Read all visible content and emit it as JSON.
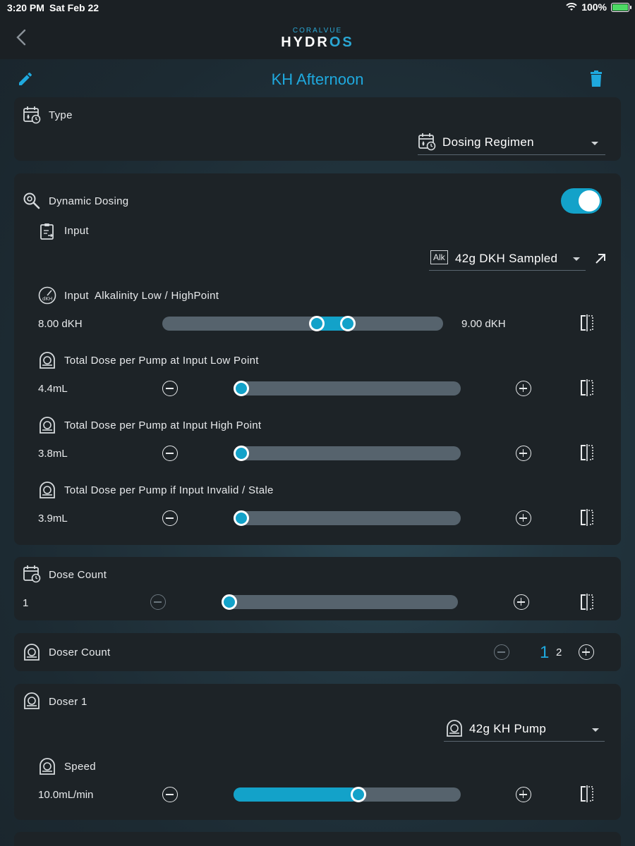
{
  "status": {
    "time": "3:20 PM",
    "date": "Sat Feb 22",
    "battery": "100%"
  },
  "nav": {
    "logo_sub": "CORALVUE",
    "logo_main_a": "HYDR",
    "logo_main_b": "OS"
  },
  "page": {
    "title": "KH Afternoon"
  },
  "type_card": {
    "label": "Type",
    "selected": "Dosing Regimen"
  },
  "dynamic": {
    "label": "Dynamic Dosing",
    "enabled": true,
    "input_label": "Input",
    "input_badge": "Alk",
    "input_selected": "42g DKH Sampled",
    "range_label": "Input  Alkalinity Low / HighPoint",
    "range_low": "8.00 dKH",
    "range_high": "9.00 dKH",
    "range_low_frac": 0.55,
    "range_high_frac": 0.66,
    "low_label": "Total Dose per Pump at Input Low Point",
    "low_value": "4.4mL",
    "high_label": "Total Dose per Pump at Input High Point",
    "high_value": "3.8mL",
    "invalid_label": "Total Dose per Pump if Input Invalid / Stale",
    "invalid_value": "3.9mL"
  },
  "dose_count": {
    "label": "Dose Count",
    "value": "1"
  },
  "doser_count": {
    "label": "Doser Count",
    "current": "1",
    "next": "2"
  },
  "doser1": {
    "label": "Doser 1",
    "selected": "42g KH Pump",
    "speed_label": "Speed",
    "speed_value": "10.0mL/min",
    "speed_frac": 0.55
  },
  "colors": {
    "accent": "#13a2c9",
    "card": "#1d2327",
    "track": "#56636d"
  }
}
